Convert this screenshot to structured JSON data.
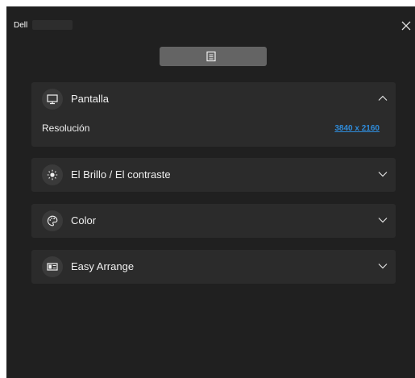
{
  "window": {
    "title": "Dell"
  },
  "sections": [
    {
      "label": "Pantalla",
      "icon": "monitor-icon",
      "expanded": true
    },
    {
      "label": "El Brillo / El contraste",
      "icon": "brightness-icon",
      "expanded": false
    },
    {
      "label": "Color",
      "icon": "palette-icon",
      "expanded": false
    },
    {
      "label": "Easy Arrange",
      "icon": "layout-icon",
      "expanded": false
    }
  ],
  "pantalla": {
    "resolution_label": "Resolución",
    "resolution_value": "3840 x 2160"
  },
  "colors": {
    "background": "#202020",
    "panel": "#2b2b2b",
    "link": "#2f8bd9",
    "toolbar_button": "#646464"
  }
}
